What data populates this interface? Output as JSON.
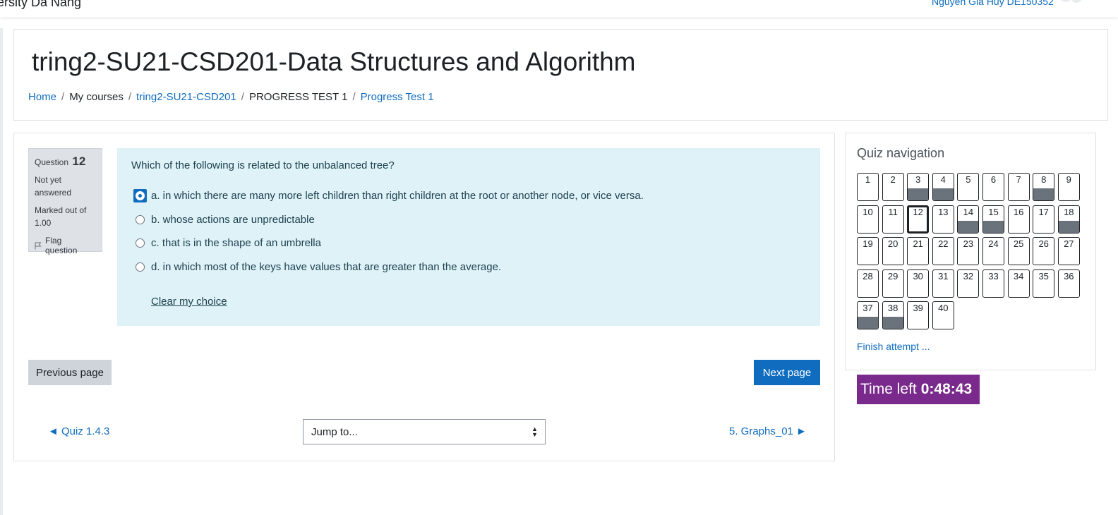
{
  "topbar": {
    "site_name": "ersity Da Nang",
    "user_name": "Nguyen Gia Huy DE150352"
  },
  "course": {
    "title": "tring2-SU21-CSD201-Data Structures and Algorithm",
    "breadcrumb": [
      {
        "label": "Home",
        "link": true
      },
      {
        "label": "My courses",
        "link": false
      },
      {
        "label": "tring2-SU21-CSD201",
        "link": true
      },
      {
        "label": "PROGRESS TEST 1",
        "link": false
      },
      {
        "label": "Progress Test 1",
        "link": true
      }
    ]
  },
  "question": {
    "label": "Question",
    "number": "12",
    "state": "Not yet answered",
    "grade": "Marked out of 1.00",
    "flag_label": "Flag question",
    "text": "Which of the following is related to the unbalanced tree?",
    "answers": [
      {
        "label": "a. in which there are many more left children than right children at the root or another node, or vice versa.",
        "selected": true
      },
      {
        "label": "b. whose actions are unpredictable",
        "selected": false
      },
      {
        "label": "c. that is in the shape of an umbrella",
        "selected": false
      },
      {
        "label": "d. in which most of the keys have values that are greater than the average.",
        "selected": false
      }
    ],
    "clear_label": "Clear my choice"
  },
  "navigation": {
    "previous_label": "Previous page",
    "next_label": "Next page",
    "prev_activity": "◄ Quiz 1.4.3",
    "next_activity": "5. Graphs_01 ►",
    "jump_placeholder": "Jump to..."
  },
  "quiz_nav": {
    "title": "Quiz navigation",
    "questions": [
      {
        "n": "1",
        "answered": false
      },
      {
        "n": "2",
        "answered": false
      },
      {
        "n": "3",
        "answered": true
      },
      {
        "n": "4",
        "answered": true
      },
      {
        "n": "5",
        "answered": false
      },
      {
        "n": "6",
        "answered": false
      },
      {
        "n": "7",
        "answered": false
      },
      {
        "n": "8",
        "answered": true
      },
      {
        "n": "9",
        "answered": false
      },
      {
        "n": "10",
        "answered": false
      },
      {
        "n": "11",
        "answered": false
      },
      {
        "n": "12",
        "answered": false,
        "current": true
      },
      {
        "n": "13",
        "answered": false
      },
      {
        "n": "14",
        "answered": true
      },
      {
        "n": "15",
        "answered": true
      },
      {
        "n": "16",
        "answered": false
      },
      {
        "n": "17",
        "answered": false
      },
      {
        "n": "18",
        "answered": true
      },
      {
        "n": "19",
        "answered": false
      },
      {
        "n": "20",
        "answered": false
      },
      {
        "n": "21",
        "answered": false
      },
      {
        "n": "22",
        "answered": false
      },
      {
        "n": "23",
        "answered": false
      },
      {
        "n": "24",
        "answered": false
      },
      {
        "n": "25",
        "answered": false
      },
      {
        "n": "26",
        "answered": false
      },
      {
        "n": "27",
        "answered": false
      },
      {
        "n": "28",
        "answered": false
      },
      {
        "n": "29",
        "answered": false
      },
      {
        "n": "30",
        "answered": false
      },
      {
        "n": "31",
        "answered": false
      },
      {
        "n": "32",
        "answered": false
      },
      {
        "n": "33",
        "answered": false
      },
      {
        "n": "34",
        "answered": false
      },
      {
        "n": "35",
        "answered": false
      },
      {
        "n": "36",
        "answered": false
      },
      {
        "n": "37",
        "answered": true
      },
      {
        "n": "38",
        "answered": true
      },
      {
        "n": "39",
        "answered": false
      },
      {
        "n": "40",
        "answered": false
      }
    ],
    "finish_label": "Finish attempt ..."
  },
  "timer": {
    "label": "Time left",
    "value": "0:48:43"
  },
  "colors": {
    "link": "#0f6cbf",
    "timer_bg": "#7a2a8c",
    "question_bg": "#def2f8",
    "answered_fill": "#6a737b"
  }
}
